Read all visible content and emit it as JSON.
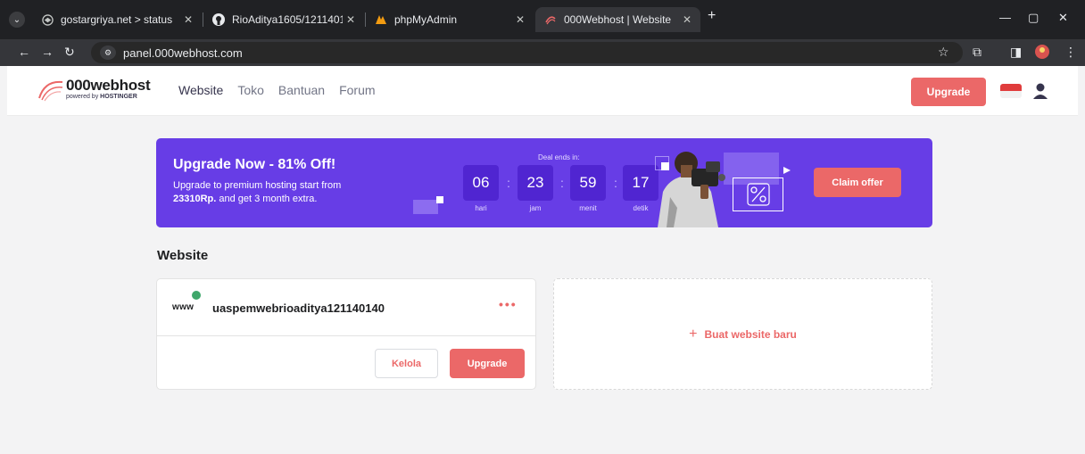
{
  "browser": {
    "tabs": [
      {
        "title": "gostargriya.net > status",
        "active": false
      },
      {
        "title": "RioAditya1605/121140140_Rio",
        "active": false
      },
      {
        "title": "phpMyAdmin",
        "active": false
      },
      {
        "title": "000Webhost | Website",
        "active": true
      }
    ],
    "url": "panel.000webhost.com"
  },
  "header": {
    "logo_main": "000webhost",
    "logo_sub_prefix": "powered by ",
    "logo_sub_brand": "HOSTINGER",
    "nav": [
      {
        "label": "Website",
        "active": true
      },
      {
        "label": "Toko",
        "active": false
      },
      {
        "label": "Bantuan",
        "active": false
      },
      {
        "label": "Forum",
        "active": false
      }
    ],
    "upgrade_label": "Upgrade"
  },
  "promo": {
    "title": "Upgrade Now - 81% Off!",
    "desc_line1": "Upgrade to premium hosting start from",
    "desc_price": "23310Rp.",
    "desc_rest": " and get 3 month extra.",
    "deal_label": "Deal ends in:",
    "countdown": [
      {
        "value": "06",
        "unit": "hari"
      },
      {
        "value": "23",
        "unit": "jam"
      },
      {
        "value": "59",
        "unit": "menit"
      },
      {
        "value": "17",
        "unit": "detik"
      }
    ],
    "claim_label": "Claim offer"
  },
  "section_title": "Website",
  "site": {
    "prefix": "www",
    "name": "uaspemwebrioaditya121140140",
    "more": "•••",
    "manage_label": "Kelola",
    "upgrade_label": "Upgrade"
  },
  "new_site": {
    "plus": "+",
    "label": "Buat website baru"
  },
  "colors": {
    "brand_purple": "#673de6",
    "accent_red": "#eb6868",
    "status_green": "#3fa76b"
  }
}
